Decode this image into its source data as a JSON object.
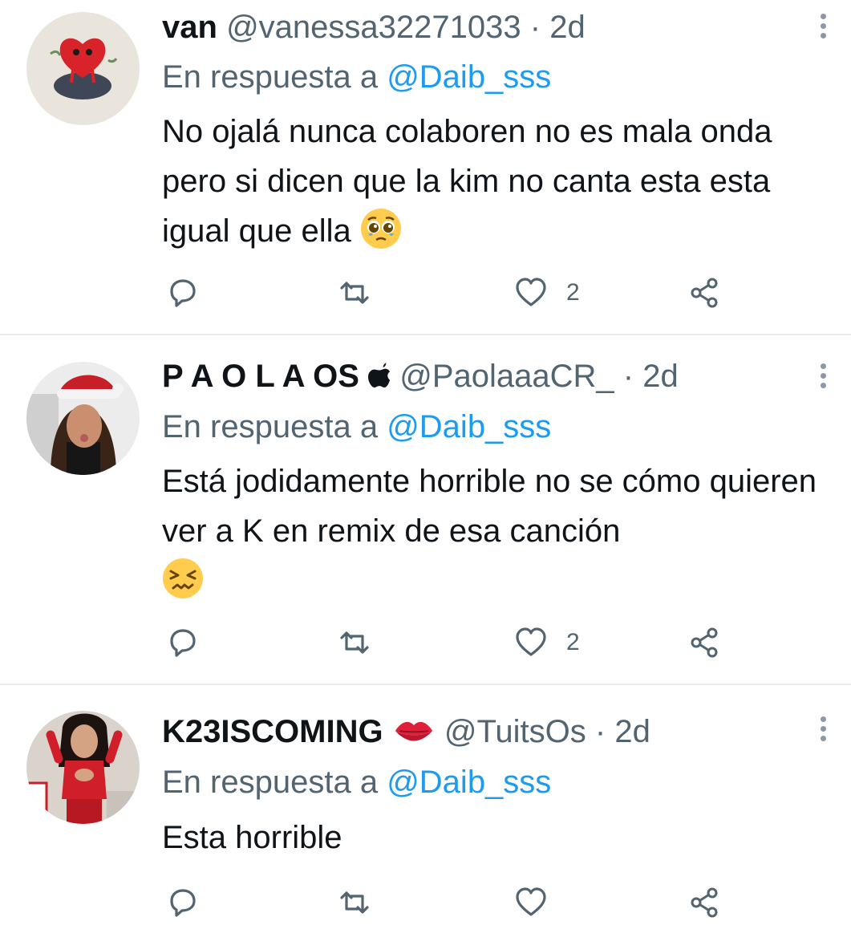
{
  "tweets": [
    {
      "name": "van",
      "handle": "@vanessa32271033",
      "separator": "·",
      "time": "2d",
      "reply_prefix": "En respuesta a",
      "reply_to": "@Daib_sss",
      "text": "No ojalá nunca colaboren no es mala onda pero si dicen que la kim no canta esta esta igual que ella",
      "emoji": "pleading-face",
      "likes": "2",
      "avatar": "heart-character-avatar"
    },
    {
      "name": "P A O L A OS",
      "name_icon": "apple-icon",
      "handle": "@PaolaaaCR_",
      "separator": "·",
      "time": "2d",
      "reply_prefix": "En respuesta a",
      "reply_to": "@Daib_sss",
      "text": "Está jodidamente horrible no se cómo quieren ver a K en remix de esa canción",
      "emoji": "confounded-face",
      "likes": "2",
      "avatar": "girl-santa-hat-avatar"
    },
    {
      "name": "K23ISCOMING",
      "name_icon": "kiss-mark-icon",
      "handle": "@TuitsOs",
      "separator": "·",
      "time": "2d",
      "reply_prefix": "En respuesta a",
      "reply_to": "@Daib_sss",
      "text": "Esta horrible",
      "likes": "",
      "avatar": "woman-red-outfit-avatar"
    }
  ],
  "colors": {
    "text": "#0f1419",
    "secondary": "#536471",
    "mention": "#1d9bf0",
    "divider": "#e9ecef",
    "icon": "#536471"
  },
  "icons": {
    "reply": "reply-icon",
    "retweet": "retweet-icon",
    "like": "heart-icon",
    "share": "share-icon",
    "more": "more-options-icon"
  }
}
